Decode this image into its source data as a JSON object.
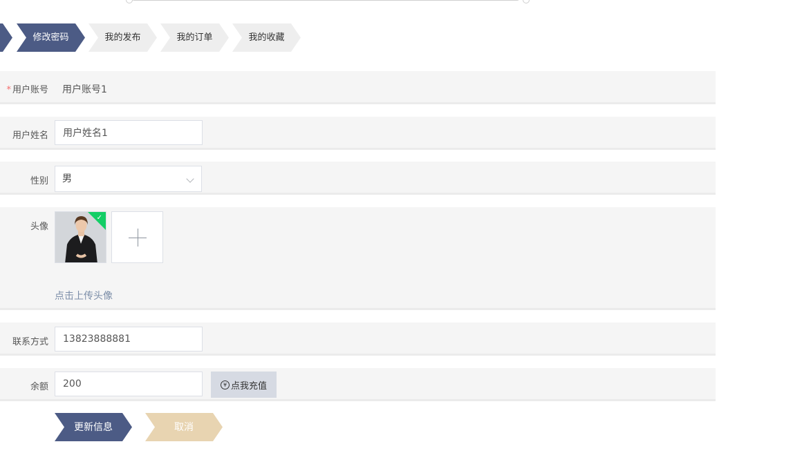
{
  "tabs": [
    {
      "label": "修改密码",
      "active": true
    },
    {
      "label": "我的发布",
      "active": false
    },
    {
      "label": "我的订单",
      "active": false
    },
    {
      "label": "我的收藏",
      "active": false
    }
  ],
  "form": {
    "account": {
      "required_mark": "*",
      "label": "用户账号",
      "value": "用户账号1"
    },
    "name": {
      "label": "用户姓名",
      "value": "用户姓名1"
    },
    "gender": {
      "label": "性别",
      "value": "男"
    },
    "avatar": {
      "label": "头像",
      "hint": "点击上传头像"
    },
    "phone": {
      "label": "联系方式",
      "value": "13823888881"
    },
    "balance": {
      "label": "余额",
      "value": "200",
      "recharge_icon": "¥",
      "recharge_label": "点我充值"
    }
  },
  "actions": {
    "update_label": "更新信息",
    "cancel_label": "取消"
  },
  "colors": {
    "primary": "#4c5b85",
    "cancel": "#e8d4b1",
    "recharge_bg": "#d6dae3",
    "success": "#13ce66",
    "required": "#f56c6c"
  }
}
